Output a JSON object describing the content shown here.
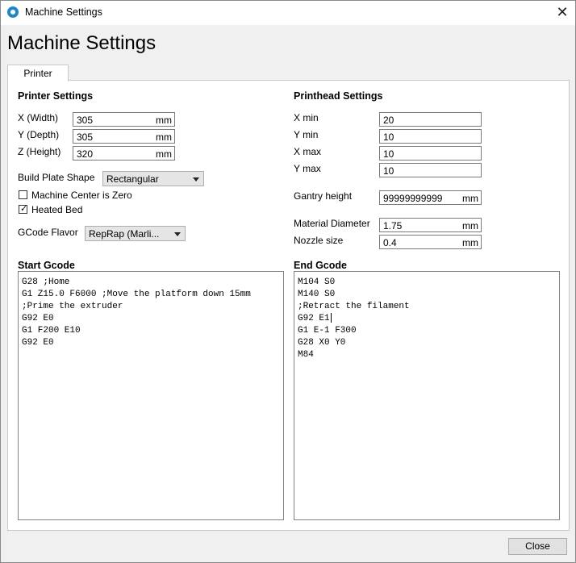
{
  "window": {
    "title": "Machine Settings",
    "close_glyph": "✕"
  },
  "heading": "Machine Settings",
  "tab": {
    "label": "Printer"
  },
  "printer": {
    "title": "Printer Settings",
    "width": {
      "label": "X (Width)",
      "value": "305",
      "unit": "mm"
    },
    "depth": {
      "label": "Y (Depth)",
      "value": "305",
      "unit": "mm"
    },
    "height": {
      "label": "Z (Height)",
      "value": "320",
      "unit": "mm"
    },
    "build_plate": {
      "label": "Build Plate Shape",
      "value": "Rectangular"
    },
    "center_zero": {
      "label": "Machine Center is Zero",
      "checked": false
    },
    "heated_bed": {
      "label": "Heated Bed",
      "checked": true
    },
    "gcode_flavor": {
      "label": "GCode Flavor",
      "value": "RepRap (Marli..."
    }
  },
  "printhead": {
    "title": "Printhead Settings",
    "xmin": {
      "label": "X min",
      "value": "20"
    },
    "ymin": {
      "label": "Y min",
      "value": "10"
    },
    "xmax": {
      "label": "X max",
      "value": "10"
    },
    "ymax": {
      "label": "Y max",
      "value": "10"
    },
    "gantry": {
      "label": "Gantry height",
      "value": "99999999999",
      "unit": "mm"
    },
    "material": {
      "label": "Material Diameter",
      "value": "1.75",
      "unit": "mm"
    },
    "nozzle": {
      "label": "Nozzle size",
      "value": "0.4",
      "unit": "mm"
    }
  },
  "start_gcode": {
    "title": "Start Gcode",
    "lines": [
      "G28 ;Home",
      "G1 Z15.0 F6000 ;Move the platform down 15mm",
      ";Prime the extruder",
      "G92 E0",
      "G1 F200 E10",
      "G92 E0"
    ]
  },
  "end_gcode": {
    "title": "End Gcode",
    "lines": [
      "M104 S0",
      "M140 S0",
      ";Retract the filament",
      "G92 E1",
      "G1 E-1 F300",
      "G28 X0 Y0",
      "M84"
    ]
  },
  "footer": {
    "close_label": "Close"
  }
}
